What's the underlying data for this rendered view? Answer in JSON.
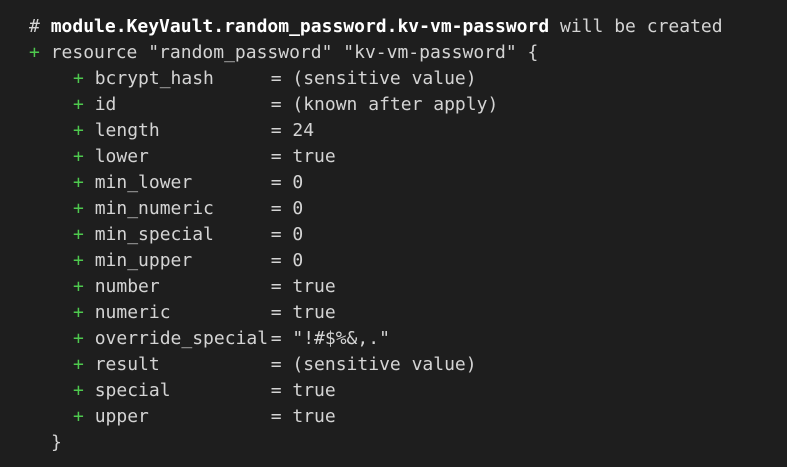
{
  "header": {
    "hash": "#",
    "address": "module.KeyVault.random_password.kv-vm-password",
    "action": "will be created"
  },
  "resource": {
    "plus": "+",
    "declaration": "resource \"random_password\" \"kv-vm-password\" {",
    "closing_brace": "}"
  },
  "attributes": [
    {
      "plus": "+",
      "name": "bcrypt_hash",
      "eq": "=",
      "value": "(sensitive value)"
    },
    {
      "plus": "+",
      "name": "id",
      "eq": "=",
      "value": "(known after apply)"
    },
    {
      "plus": "+",
      "name": "length",
      "eq": "=",
      "value": "24"
    },
    {
      "plus": "+",
      "name": "lower",
      "eq": "=",
      "value": "true"
    },
    {
      "plus": "+",
      "name": "min_lower",
      "eq": "=",
      "value": "0"
    },
    {
      "plus": "+",
      "name": "min_numeric",
      "eq": "=",
      "value": "0"
    },
    {
      "plus": "+",
      "name": "min_special",
      "eq": "=",
      "value": "0"
    },
    {
      "plus": "+",
      "name": "min_upper",
      "eq": "=",
      "value": "0"
    },
    {
      "plus": "+",
      "name": "number",
      "eq": "=",
      "value": "true"
    },
    {
      "plus": "+",
      "name": "numeric",
      "eq": "=",
      "value": "true"
    },
    {
      "plus": "+",
      "name": "override_special",
      "eq": "=",
      "value": "\"!#$%&,.\""
    },
    {
      "plus": "+",
      "name": "result",
      "eq": "=",
      "value": "(sensitive value)"
    },
    {
      "plus": "+",
      "name": "special",
      "eq": "=",
      "value": "true"
    },
    {
      "plus": "+",
      "name": "upper",
      "eq": "=",
      "value": "true"
    }
  ],
  "colors": {
    "background": "#1e1e1e",
    "text": "#d4d4d4",
    "added": "#4ec94e",
    "address": "#ffffff"
  }
}
